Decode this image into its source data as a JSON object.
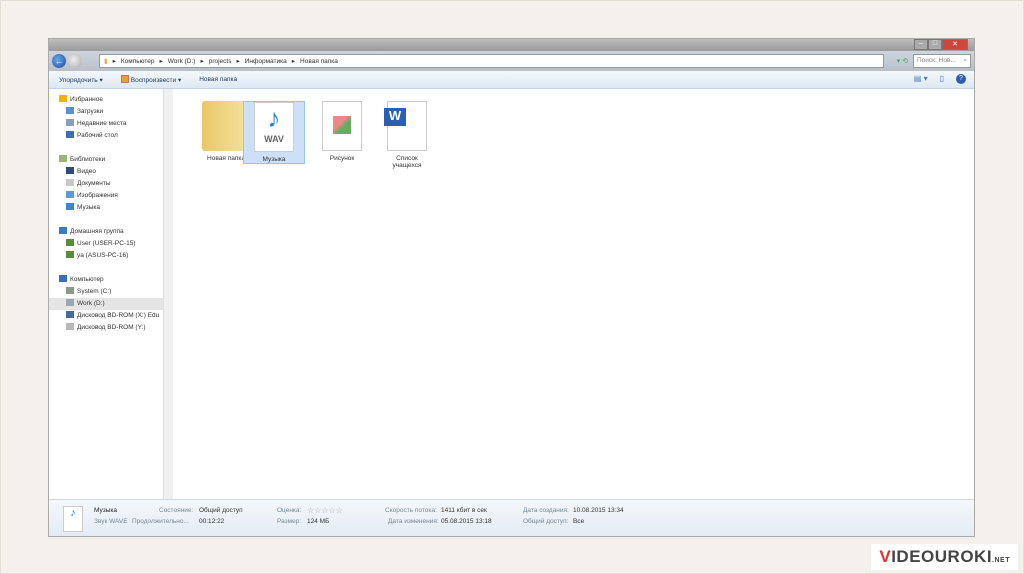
{
  "address": {
    "breadcrumbs": [
      "Компьютер",
      "Work (D:)",
      "projects",
      "Информатика",
      "Новая папка"
    ],
    "search_placeholder": "Поиск: Нов..."
  },
  "toolbar": {
    "organize": "Упорядочить ▾",
    "play": "Воспроизвести ▾",
    "new_folder": "Новая папка"
  },
  "nav": {
    "items": [
      {
        "label": "Избранное",
        "type": "h",
        "icon": "star-icon",
        "color": "#f0b400"
      },
      {
        "label": "Загрузки",
        "type": "c",
        "icon": "downloads-icon",
        "color": "#5b8fcf"
      },
      {
        "label": "Недавние места",
        "type": "c",
        "icon": "recent-places-icon",
        "color": "#8aa0b8"
      },
      {
        "label": "Рабочий стол",
        "type": "c",
        "icon": "desktop-icon",
        "color": "#3d6db3"
      },
      {
        "label": "",
        "type": "gap"
      },
      {
        "label": "Библиотеки",
        "type": "h",
        "icon": "libraries-icon",
        "color": "#9db57a"
      },
      {
        "label": "Видео",
        "type": "c",
        "icon": "video-icon",
        "color": "#2f4d7a"
      },
      {
        "label": "Документы",
        "type": "c",
        "icon": "documents-icon",
        "color": "#c9c9c9"
      },
      {
        "label": "Изображения",
        "type": "c",
        "icon": "images-icon",
        "color": "#5b9bd5"
      },
      {
        "label": "Музыка",
        "type": "c",
        "icon": "music-icon",
        "color": "#3a86d1"
      },
      {
        "label": "",
        "type": "gap"
      },
      {
        "label": "Домашняя группа",
        "type": "h",
        "icon": "homegroup-icon",
        "color": "#3b7bbf"
      },
      {
        "label": "User (USER-PC-15)",
        "type": "c",
        "icon": "user-icon",
        "color": "#5a8a3c"
      },
      {
        "label": "ya (ASUS-PC-16)",
        "type": "c",
        "icon": "user-icon",
        "color": "#5a8a3c"
      },
      {
        "label": "",
        "type": "gap"
      },
      {
        "label": "Компьютер",
        "type": "h",
        "icon": "computer-icon",
        "color": "#3b6fb3"
      },
      {
        "label": "System (C:)",
        "type": "c",
        "icon": "drive-icon",
        "color": "#8a9a88"
      },
      {
        "label": "Work (D:)",
        "type": "c",
        "icon": "drive-icon",
        "color": "#9aa6b0",
        "selected": true
      },
      {
        "label": "Дисковод BD-ROM (X:) Edu",
        "type": "c",
        "icon": "bd-rom-icon",
        "color": "#4a6a9a"
      },
      {
        "label": "Дисковод BD-ROM (Y:)",
        "type": "c",
        "icon": "disc-icon",
        "color": "#b8b8b8"
      }
    ]
  },
  "files": [
    {
      "label": "Новая папка",
      "kind": "folder"
    },
    {
      "label": "Музыка",
      "kind": "wav",
      "badge": "WAV",
      "selected": true
    },
    {
      "label": "Рисунок",
      "kind": "image"
    },
    {
      "label": "Список учащехся",
      "kind": "word",
      "badge": "W"
    }
  ],
  "status": {
    "name": "Музыка",
    "type": "Звук WAVE",
    "state_label": "Состояние:",
    "state": "Общий доступ",
    "duration_label": "Продолжительно...",
    "duration": "00:12:22",
    "rating_label": "Оценка:",
    "rating": "☆☆☆☆☆",
    "size_label": "Размер:",
    "size": "124 МБ",
    "bitrate_label": "Скорость потока:",
    "bitrate": "1411 кбит в сек",
    "modified_label": "Дата изменения:",
    "modified": "05.08.2015 13:18",
    "created_label": "Дата создания:",
    "created": "10.08.2015 13:34",
    "shared_label": "Общий доступ:",
    "shared": "Все"
  },
  "logo": {
    "text": "VIDEOUROKI.NET"
  }
}
